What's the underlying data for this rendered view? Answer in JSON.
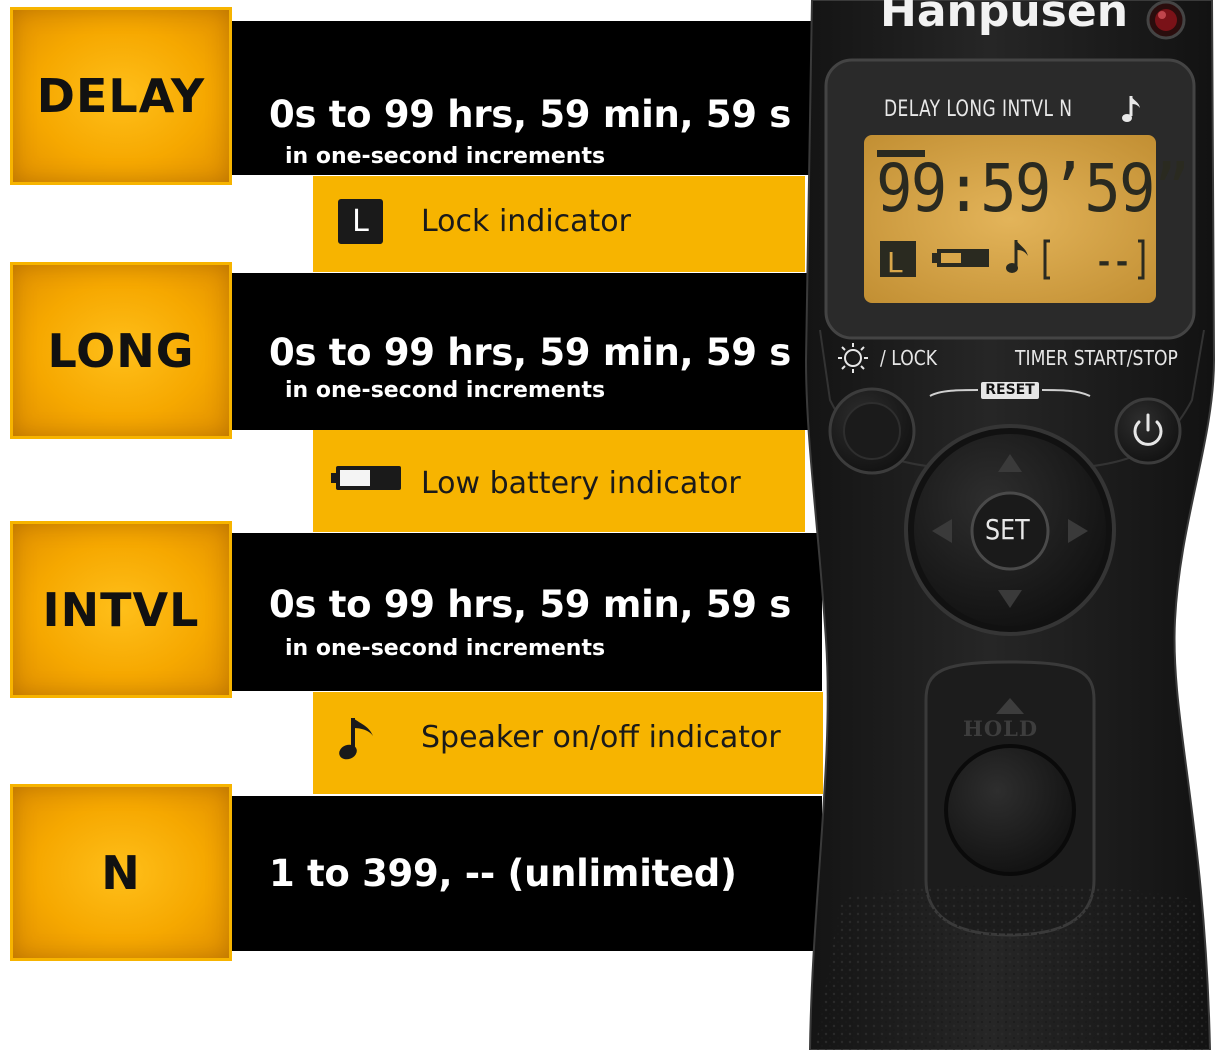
{
  "modes": [
    {
      "label": "DELAY",
      "range": "0s to 99 hrs, 59 min, 59 s",
      "increment": "in one-second increments"
    },
    {
      "label": "LONG",
      "range": "0s to 99 hrs, 59 min, 59 s",
      "increment": "in one-second increments"
    },
    {
      "label": "INTVL",
      "range": "0s to 99 hrs, 59 min, 59 s",
      "increment": "in one-second increments"
    },
    {
      "label": "N",
      "range": "1 to 399, -- (unlimited)"
    }
  ],
  "indicators": [
    {
      "icon": "lock-icon",
      "icon_text": "L",
      "text": "Lock indicator"
    },
    {
      "icon": "low-battery-icon",
      "text": "Low battery indicator"
    },
    {
      "icon": "music-note-icon",
      "text": "Speaker on/off indicator"
    }
  ],
  "remote": {
    "brand": "Hanpusen",
    "lcd_header": "DELAY  LONG  INTVL  N",
    "lcd_time": "99:59’59”",
    "lcd_lock": "L",
    "lcd_count": "--",
    "light_lock_label": "/ LOCK",
    "timer_label": "TIMER START/STOP",
    "reset_label": "RESET",
    "set_label": "SET",
    "hold_label": "HOLD"
  },
  "colors": {
    "accent_yellow": "#f7b400",
    "bar_black": "#000000",
    "lcd_amber": "#d9a74a",
    "remote_body": "#1e1e1e"
  }
}
